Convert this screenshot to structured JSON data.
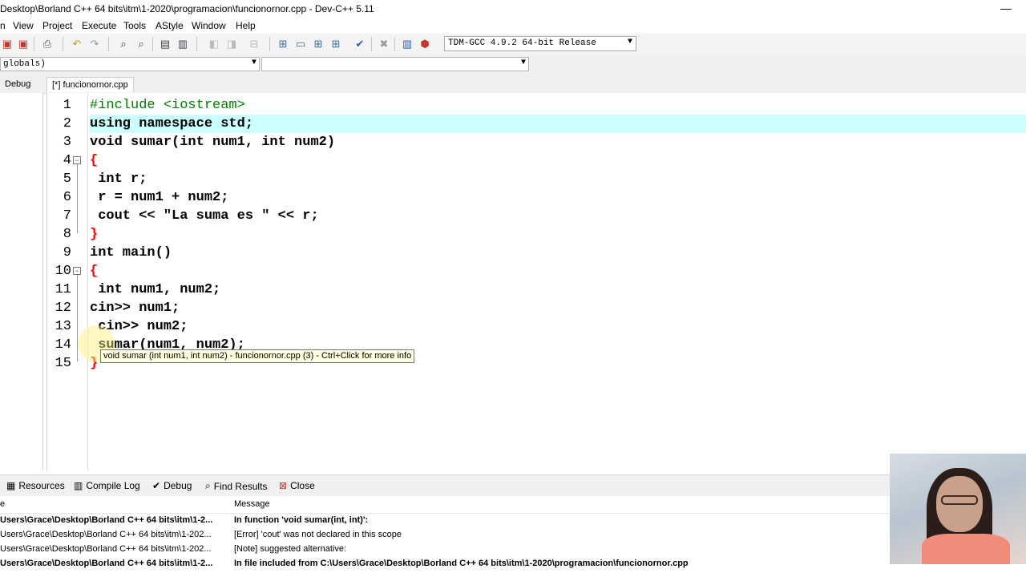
{
  "window": {
    "title": "Desktop\\Borland C++ 64 bits\\itm\\1-2020\\programacion\\funcionornor.cpp - Dev-C++ 5.11",
    "minimize_glyph": "—"
  },
  "menu": {
    "items": [
      "View",
      "Project",
      "Execute",
      "Tools",
      "AStyle",
      "Window",
      "Help"
    ]
  },
  "toolbar": {
    "compiler": "TDM-GCC 4.9.2 64-bit Release"
  },
  "classbar": {
    "scope": "globals)",
    "member": ""
  },
  "tabs": {
    "left_tab": "Debug",
    "file_tab": "[*] funcionornor.cpp"
  },
  "editor": {
    "line_numbers": [
      "1",
      "2",
      "3",
      "4",
      "5",
      "6",
      "7",
      "8",
      "9",
      "10",
      "11",
      "12",
      "13",
      "14",
      "15"
    ],
    "lines": [
      "#include <iostream>",
      "using namespace std;",
      "void sumar(int num1, int num2)",
      "{",
      " int r;",
      " r = num1 + num2;",
      " cout << \"La suma es \" << r;",
      "}",
      "int main()",
      "{",
      " int num1, num2;",
      "cin>> num1;",
      " cin>> num2;",
      " sumar(num1, num2);",
      "}"
    ],
    "tooltip": "void sumar (int num1, int num2) - funcionornor.cpp (3) - Ctrl+Click for more info"
  },
  "bottom_panel": {
    "tabs": [
      "Resources",
      "Compile Log",
      "Debug",
      "Find Results",
      "Close"
    ],
    "columns": {
      "file": "e",
      "message": "Message"
    },
    "rows": [
      {
        "file": "Users\\Grace\\Desktop\\Borland C++ 64 bits\\itm\\1-2...",
        "message": "In function 'void sumar(int, int)':",
        "bold": true
      },
      {
        "file": "Users\\Grace\\Desktop\\Borland C++ 64 bits\\itm\\1-202...",
        "message": "[Error] 'cout' was not declared in this scope",
        "bold": false
      },
      {
        "file": "Users\\Grace\\Desktop\\Borland C++ 64 bits\\itm\\1-202...",
        "message": "[Note] suggested alternative:",
        "bold": false
      },
      {
        "file": "Users\\Grace\\Desktop\\Borland C++ 64 bits\\itm\\1-2...",
        "message": "In file included from C:\\Users\\Grace\\Desktop\\Borland C++ 64 bits\\itm\\1-2020\\programacion\\funcionornor.cpp",
        "bold": true
      }
    ]
  },
  "colors": {
    "current_line": "#ccffff",
    "symbol": "#ff0000",
    "string": "#0000ff",
    "preprocessor": "#008000"
  }
}
